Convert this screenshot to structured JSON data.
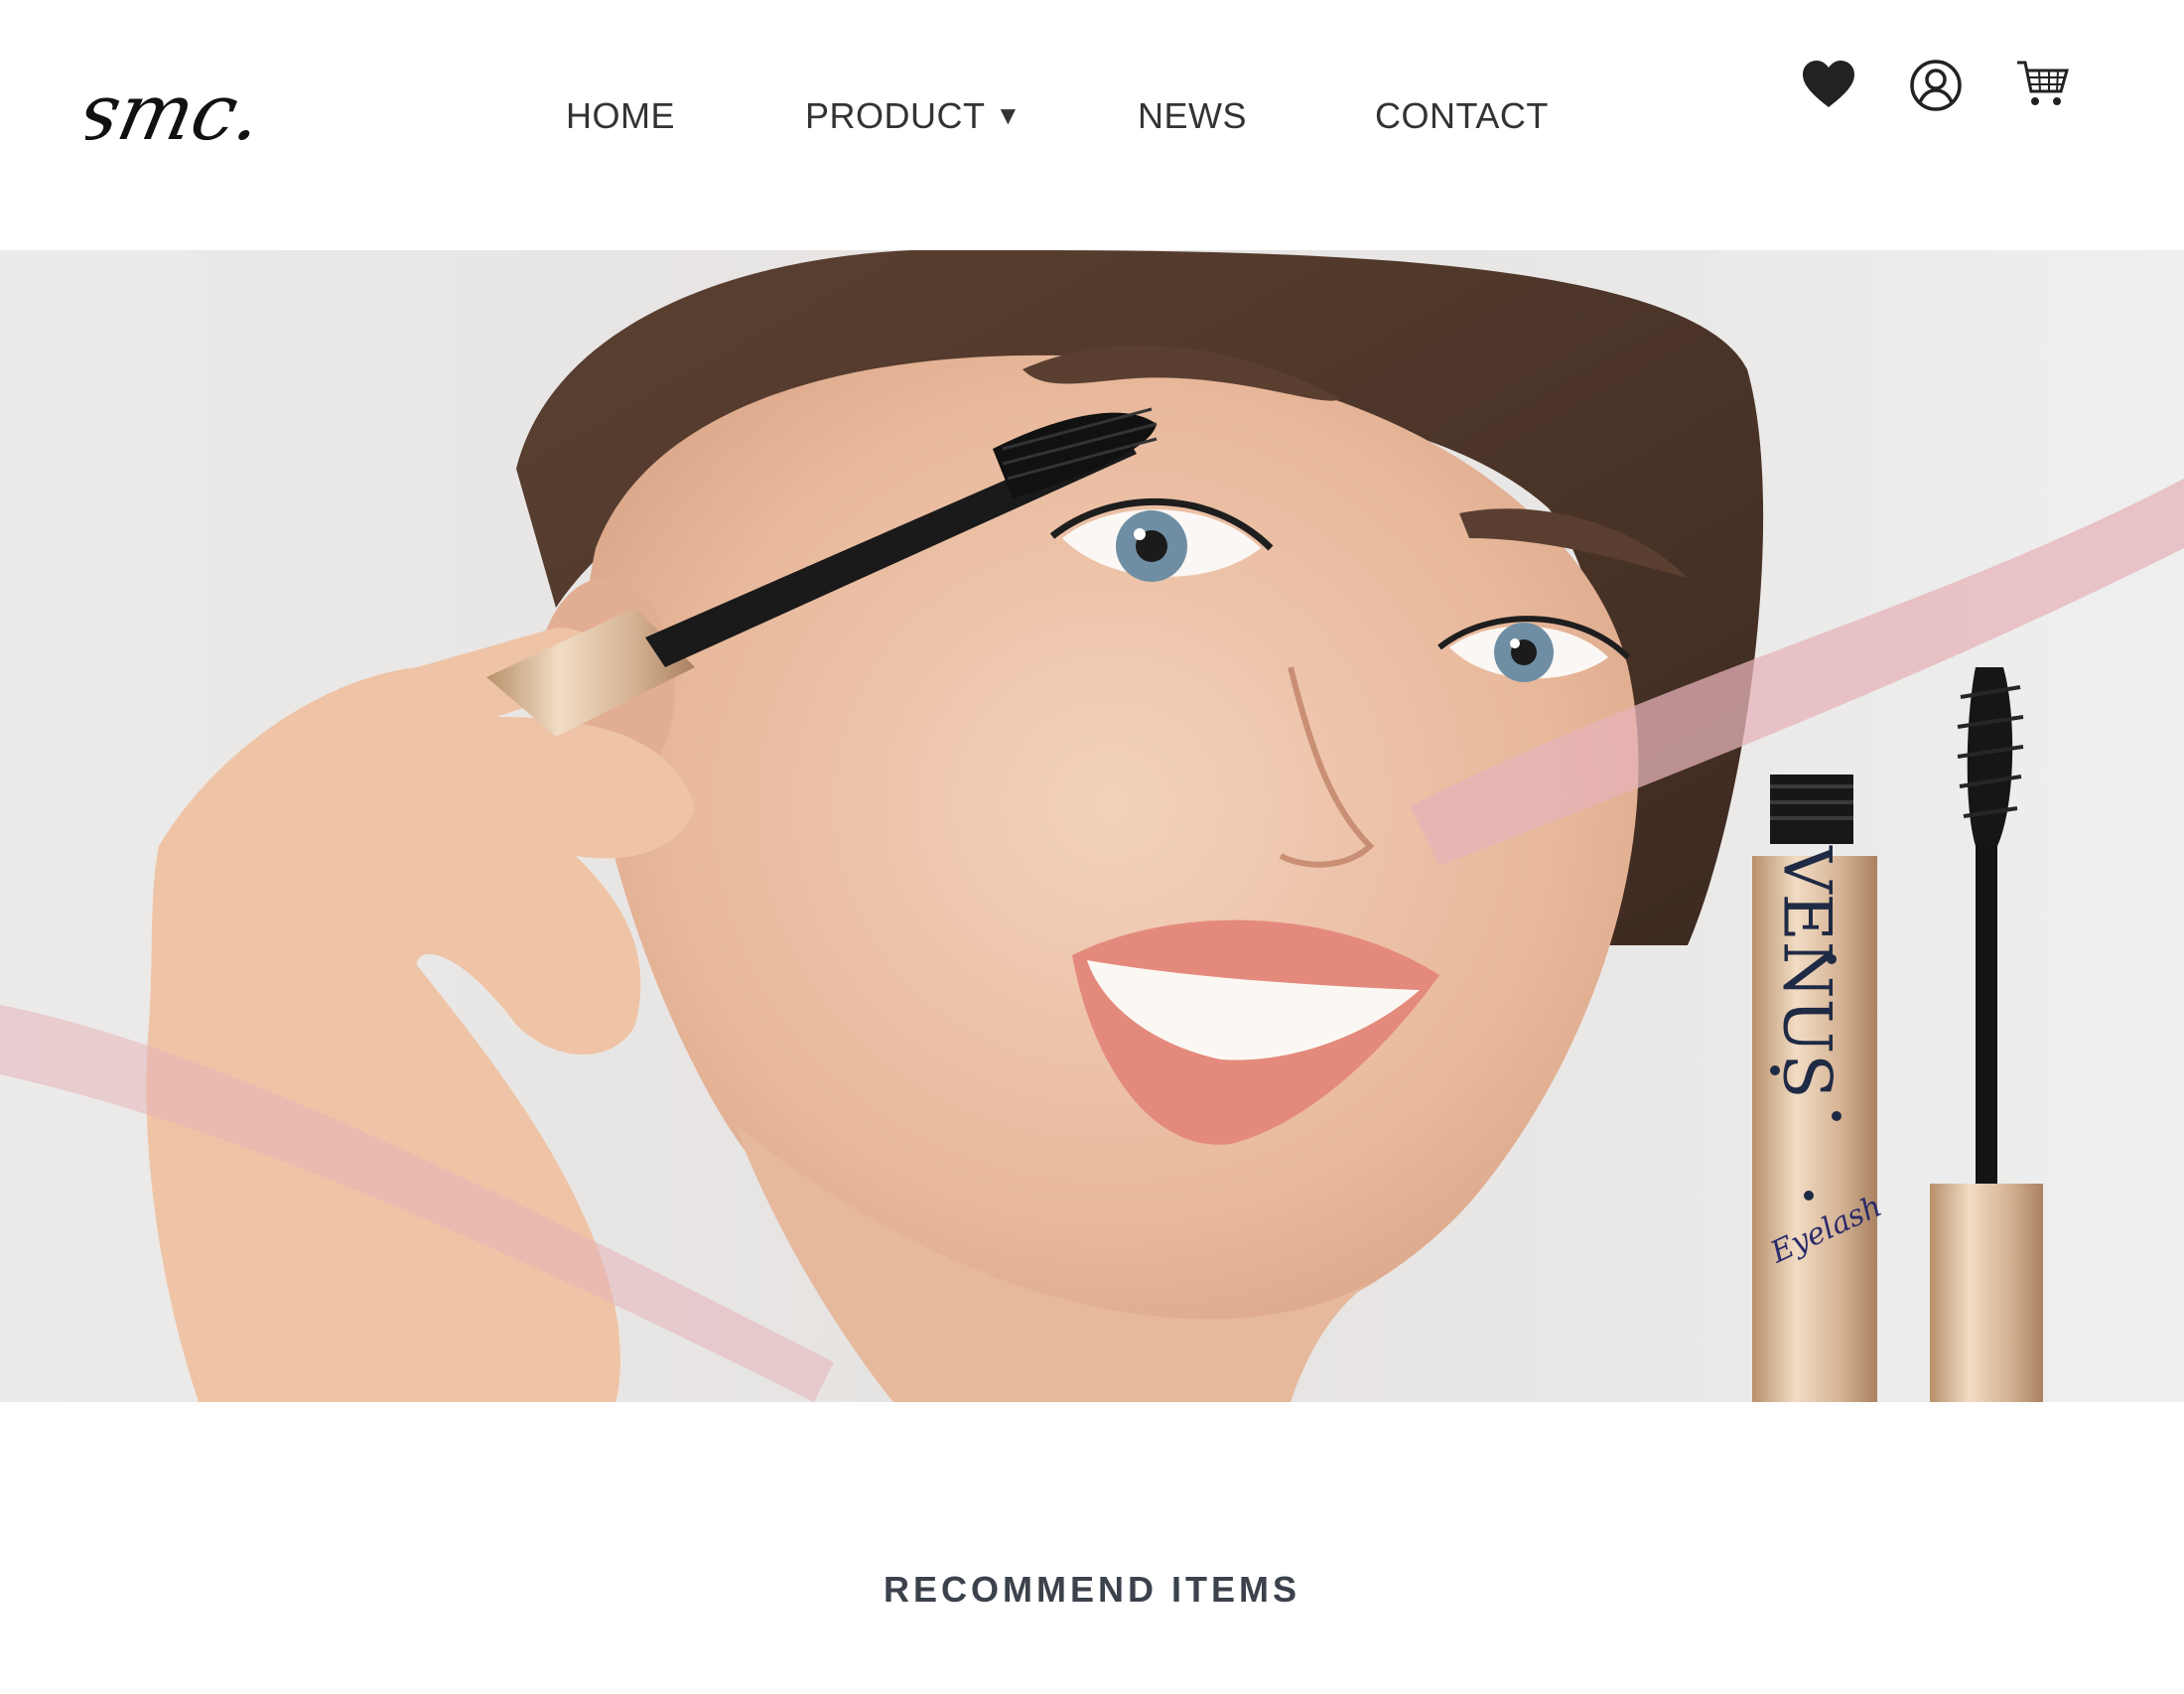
{
  "header": {
    "logo_text": "smc.",
    "nav": {
      "home": "HOME",
      "product": "PRODUCT",
      "product_caret": "▼",
      "news": "NEWS",
      "contact": "CONTACT"
    },
    "icons": {
      "favorites": "heart-icon",
      "account": "user-icon",
      "cart": "cart-icon"
    }
  },
  "hero": {
    "product_brand": "VENUS",
    "product_subline": "Eyelash",
    "colors": {
      "background": "#e9e6e4",
      "accent_stroke": "#e6b3b8",
      "tube_gold": "#d8b896",
      "brand_text": "#1f2a44"
    }
  },
  "recommend": {
    "title": "RECOMMEND ITEMS"
  }
}
